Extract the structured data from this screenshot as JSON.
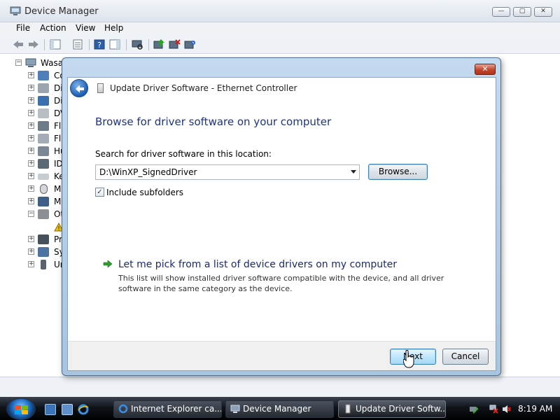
{
  "window": {
    "title": "Device Manager",
    "caption_buttons": {
      "minimize": "—",
      "maximize": "▢",
      "close": "✕"
    }
  },
  "menu": [
    "File",
    "Action",
    "View",
    "Help"
  ],
  "tree": {
    "root": "Wasa",
    "nodes": [
      {
        "label": "Co",
        "expander": "+",
        "icon": "computer-icon"
      },
      {
        "label": "Di",
        "expander": "+",
        "icon": "disk-drive-icon"
      },
      {
        "label": "Di",
        "expander": "+",
        "icon": "display-adapter-icon"
      },
      {
        "label": "DV",
        "expander": "+",
        "icon": "dvd-drive-icon"
      },
      {
        "label": "Fl",
        "expander": "+",
        "icon": "floppy-icon"
      },
      {
        "label": "Fl",
        "expander": "+",
        "icon": "floppy-drive-icon"
      },
      {
        "label": "Hu",
        "expander": "+",
        "icon": "hid-icon"
      },
      {
        "label": "ID",
        "expander": "+",
        "icon": "ide-controller-icon"
      },
      {
        "label": "Ke",
        "expander": "+",
        "icon": "keyboard-icon"
      },
      {
        "label": "M",
        "expander": "+",
        "icon": "mouse-icon"
      },
      {
        "label": "M",
        "expander": "+",
        "icon": "monitor-icon"
      },
      {
        "label": "Ot",
        "expander": "−",
        "icon": "other-devices-icon"
      },
      {
        "label": "",
        "expander": "",
        "icon": "warning-device-icon"
      },
      {
        "label": "Pr",
        "expander": "+",
        "icon": "processor-icon"
      },
      {
        "label": "Sy",
        "expander": "+",
        "icon": "system-devices-icon"
      },
      {
        "label": "Ur",
        "expander": "+",
        "icon": "usb-controller-icon"
      }
    ]
  },
  "dialog": {
    "title": "Update Driver Software - Ethernet Controller",
    "close_glyph": "✕",
    "heading": "Browse for driver software on your computer",
    "search_label": "Search for driver software in this location:",
    "path_value": "D:\\WinXP_SignedDriver",
    "browse_label": "Browse...",
    "include_subfolders": {
      "label": "Include subfolders",
      "checked": true,
      "glyph": "✓"
    },
    "pick_link": "Let me pick from a list of device drivers on my computer",
    "pick_description": "This list will show installed driver software compatible with the device, and all driver software in the same category as the device.",
    "next_label": "Next",
    "cancel_label": "Cancel"
  },
  "taskbar": {
    "tasks": [
      {
        "label": "Internet Explorer ca...",
        "icon": "ie-icon",
        "active": false
      },
      {
        "label": "Device Manager",
        "icon": "device-manager-icon",
        "active": false
      },
      {
        "label": "Update Driver Softw...",
        "icon": "update-driver-icon",
        "active": true
      }
    ],
    "clock": "8:19 AM"
  },
  "colors": {
    "heading": "#1e3287",
    "dialog_frame": "#b7cfe8",
    "taskbar": "#10141a",
    "close_button": "#c4442b"
  }
}
